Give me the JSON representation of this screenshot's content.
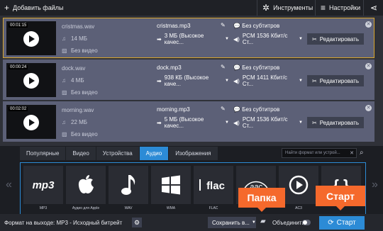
{
  "toolbar": {
    "add_files": "Добавить файлы",
    "tools": "Инструменты",
    "settings": "Настройки"
  },
  "files": [
    {
      "time": "00:01:15",
      "name": "cristmas.wav",
      "size": "14 МБ",
      "video": "Без видео",
      "out_name": "cristmas.mp3",
      "out_size": "3 МБ (Высокое качес...",
      "subtitles": "Без субтитров",
      "audio": "PCM 1536 Кбит/с Ст...",
      "edit": "Редактировать",
      "selected": true
    },
    {
      "time": "00:00:24",
      "name": "dock.wav",
      "size": "4 МБ",
      "video": "Без видео",
      "out_name": "dock.mp3",
      "out_size": "938 КБ (Высокое каче...",
      "subtitles": "Без субтитров",
      "audio": "PCM 1411 Кбит/с Ст...",
      "edit": "Редактировать",
      "selected": false
    },
    {
      "time": "00:02:02",
      "name": "morning.wav",
      "size": "22 МБ",
      "video": "Без видео",
      "out_name": "morning.mp3",
      "out_size": "5 МБ (Высокое качес...",
      "subtitles": "Без субтитров",
      "audio": "PCM 1536 Кбит/с Ст...",
      "edit": "Редактировать",
      "selected": false
    }
  ],
  "tabs": [
    "Популярные",
    "Видео",
    "Устройства",
    "Аудио",
    "Изображения"
  ],
  "active_tab": "Аудио",
  "search_placeholder": "Найти формат или устрой...",
  "formats": [
    {
      "label": "MP3",
      "icon": "mp3-icon"
    },
    {
      "label": "Аудио для Apple",
      "icon": "apple-icon"
    },
    {
      "label": "WAV",
      "icon": "music-note-icon"
    },
    {
      "label": "WMA",
      "icon": "windows-icon"
    },
    {
      "label": "FLAC",
      "icon": "flac-icon"
    },
    {
      "label": "",
      "icon": "aac-icon"
    },
    {
      "label": "AC3",
      "icon": "ac3-icon"
    },
    {
      "label": "",
      "icon": "braces-icon"
    }
  ],
  "bottom": {
    "output_format": "Формат на выходе: MP3 - Исходный битрейт",
    "save": "Сохранить в...",
    "merge": "Объединить",
    "start": "Старт"
  },
  "callouts": {
    "folder": "Папка",
    "start": "Старт"
  },
  "colors": {
    "accent": "#2c8bd6",
    "callout": "#f5692c",
    "selected_border": "#d8a52c",
    "row_bg": "#5c6077"
  }
}
